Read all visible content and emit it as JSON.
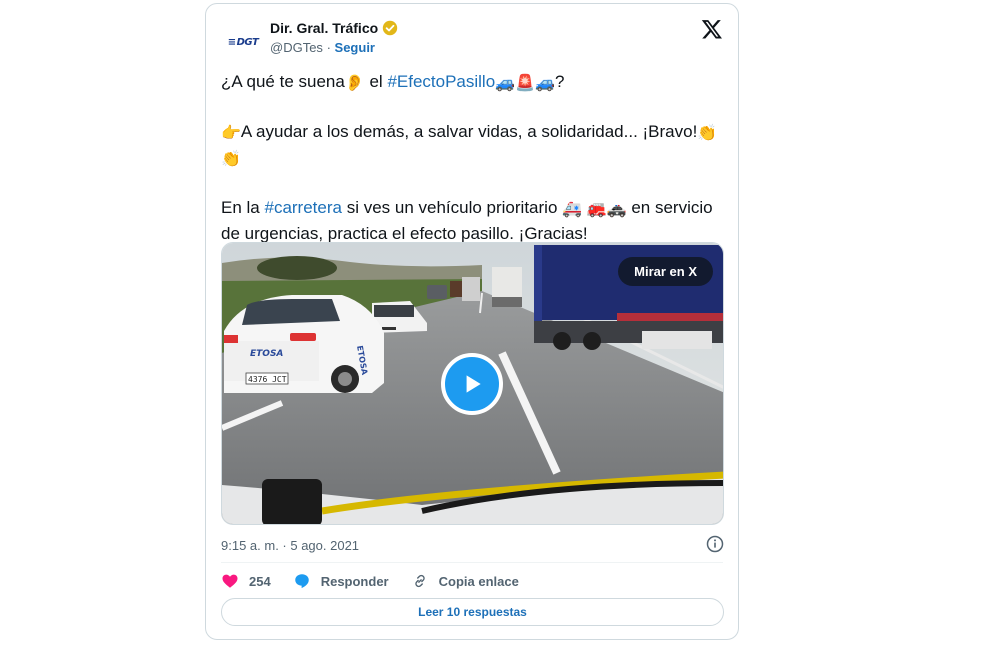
{
  "author": {
    "display_name": "Dir. Gral. Tráfico",
    "handle": "@DGTes",
    "separator": "·",
    "follow_label": "Seguir",
    "avatar_text": "DGT"
  },
  "tweet": {
    "line1_pre": "¿A qué te suena",
    "line1_mid": " el ",
    "line1_hashtag": "#EfectoPasillo",
    "line1_end": "?",
    "line2": "A ayudar a los demás, a salvar vidas, a solidaridad... ¡Bravo!",
    "line3_pre": "En la ",
    "line3_hashtag": "#carretera",
    "line3_mid": " si ves un vehículo prioritario ",
    "line3_end": " en servicio de urgencias, practica el efecto pasillo. ¡Gracias!",
    "emojis": {
      "ear": "👂",
      "car": "🚙",
      "siren": "🚨",
      "point": "👉",
      "clap": "👏",
      "ambulance": "🚑",
      "firetruck": "🚒",
      "police": "🚓"
    }
  },
  "media": {
    "watch_label": "Mirar en X",
    "car_brand": "ETOSA",
    "plate": "4376 JCT"
  },
  "meta": {
    "timestamp": "9:15 a. m. · 5 ago. 2021"
  },
  "actions": {
    "like_count": "254",
    "reply_label": "Responder",
    "copy_label": "Copia enlace"
  },
  "read_replies_label": "Leer 10 respuestas",
  "colors": {
    "link": "#1d70b8",
    "play": "#1d9bf0",
    "like": "#f91880",
    "verified": "#e2b719"
  }
}
